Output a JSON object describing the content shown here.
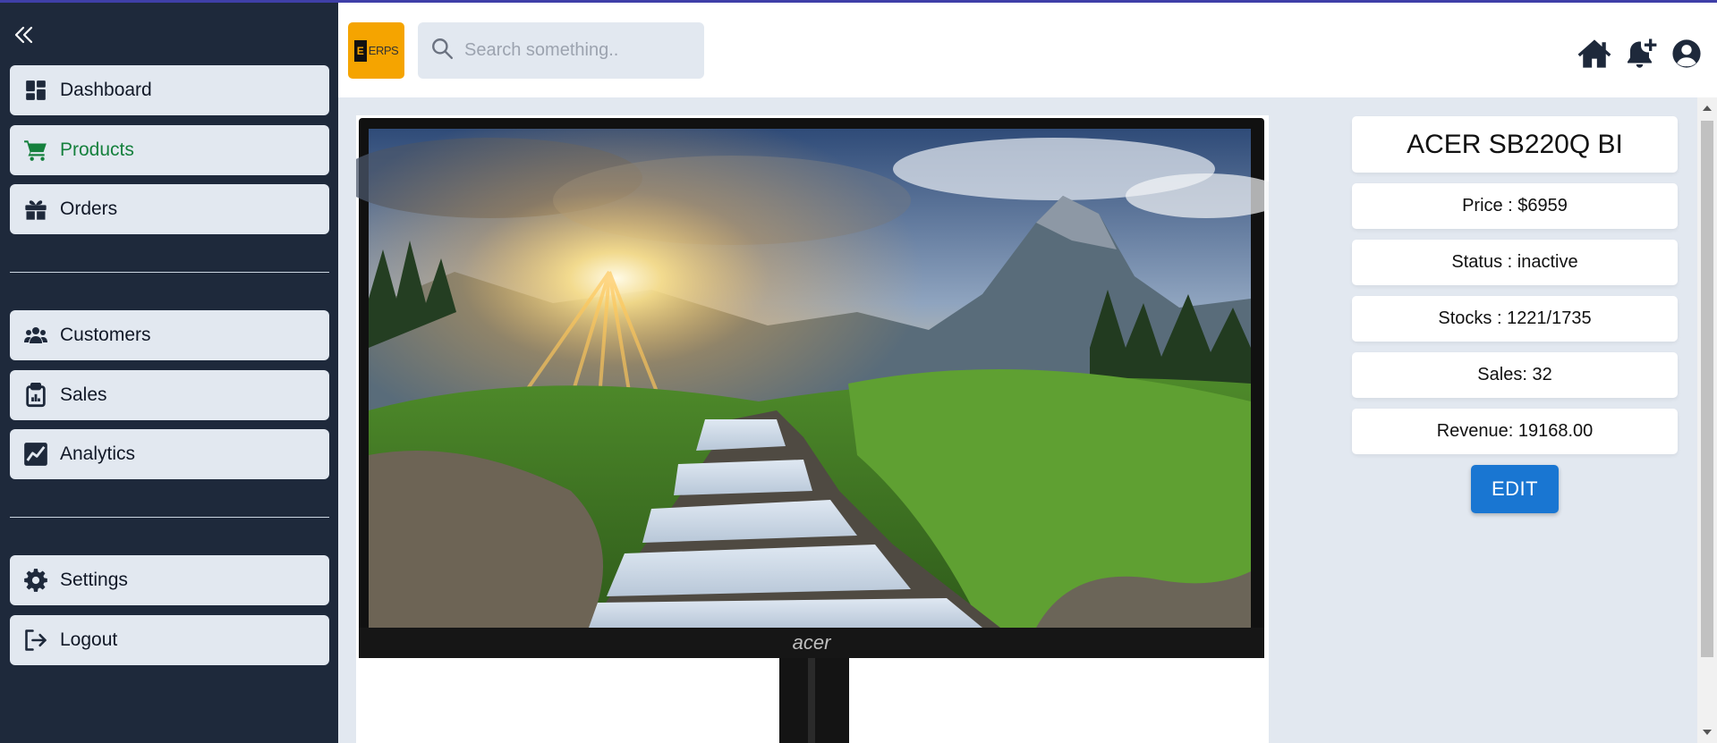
{
  "sidebar": {
    "items": [
      {
        "label": "Dashboard",
        "icon": "dashboard-icon"
      },
      {
        "label": "Products",
        "icon": "cart-icon",
        "active": true
      },
      {
        "label": "Orders",
        "icon": "gift-icon"
      },
      {
        "label": "Customers",
        "icon": "users-icon"
      },
      {
        "label": "Sales",
        "icon": "clipboard-icon"
      },
      {
        "label": "Analytics",
        "icon": "chart-line-icon"
      },
      {
        "label": "Settings",
        "icon": "gear-icon"
      },
      {
        "label": "Logout",
        "icon": "logout-icon"
      }
    ]
  },
  "header": {
    "logo_letter": "E",
    "logo_text": "ERPS",
    "search_placeholder": "Search something.."
  },
  "product": {
    "name": "ACER SB220Q BI",
    "price": "Price : $6959",
    "status": "Status : inactive",
    "stocks": "Stocks : 1221/1735",
    "sales": "Sales: 32",
    "revenue": "Revenue: 19168.00",
    "edit_label": "EDIT",
    "monitor_brand": "acer"
  },
  "colors": {
    "sidebar_bg": "#1e293b",
    "nav_bg": "#e2e8f0",
    "active_text": "#15803d",
    "accent_button": "#1976d2",
    "logo_bg": "#f5a400"
  }
}
